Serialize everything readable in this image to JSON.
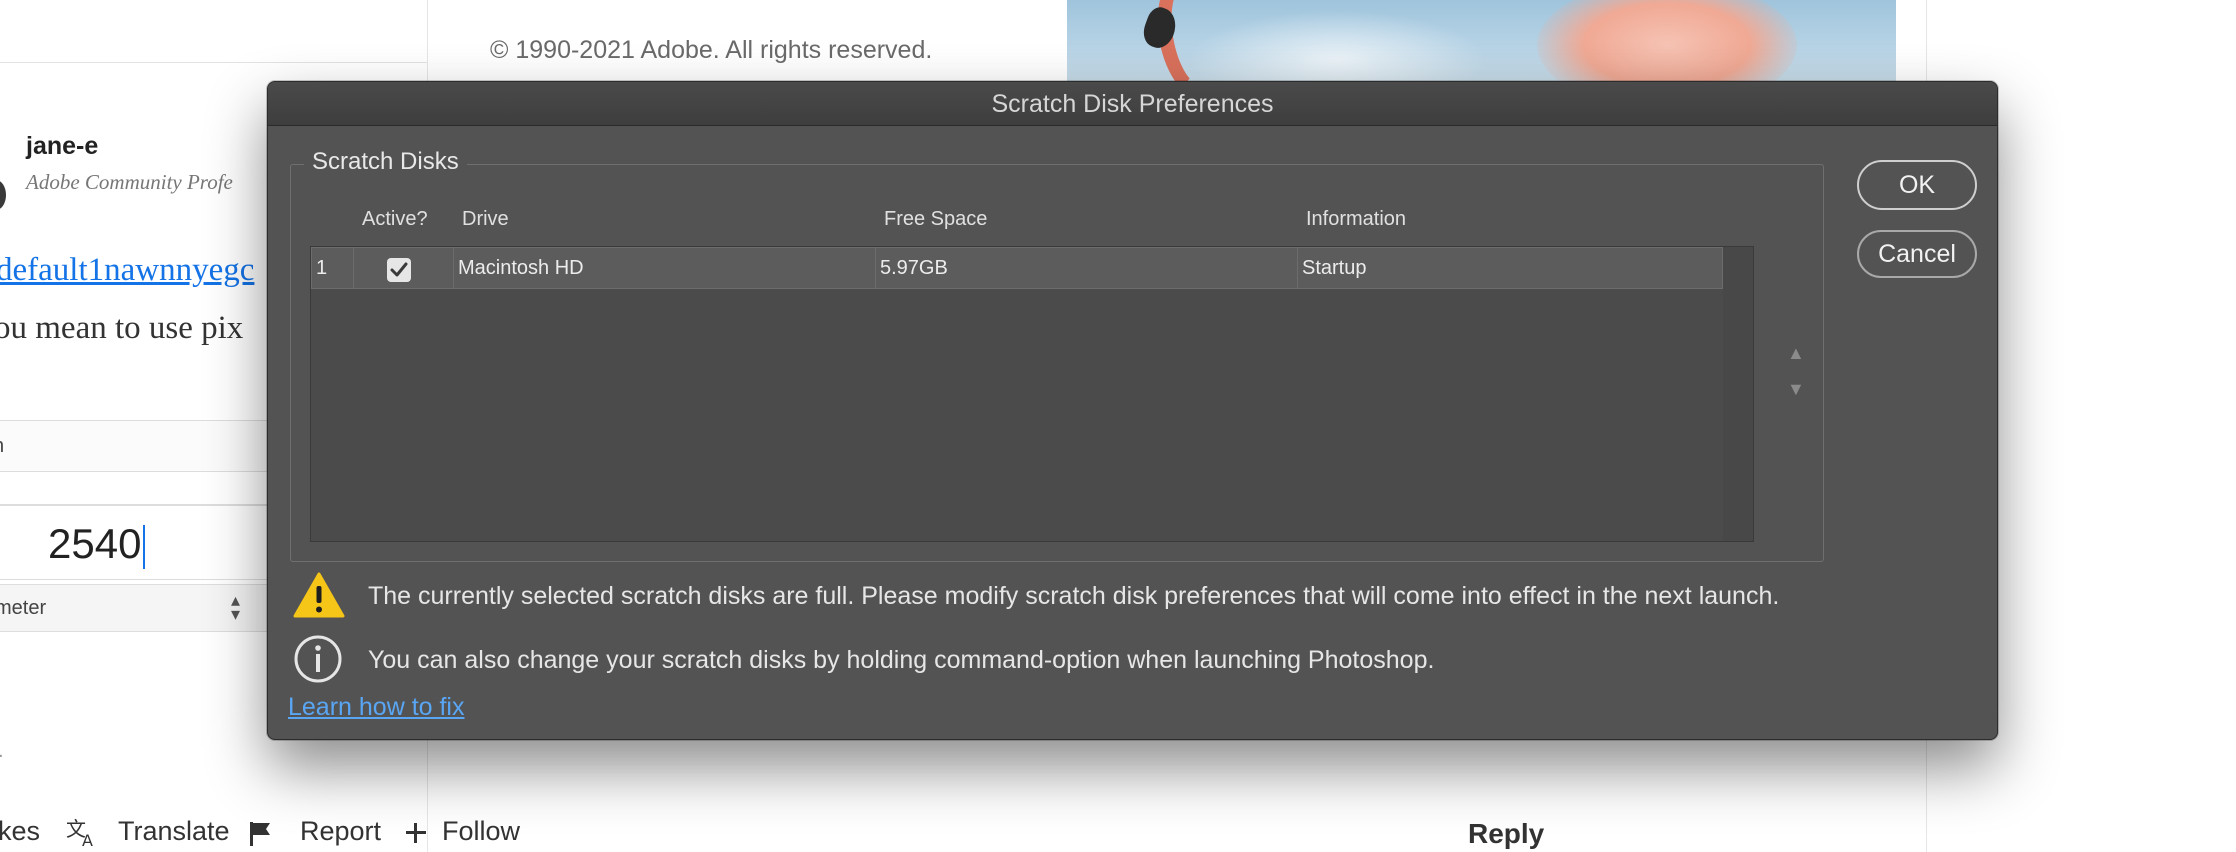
{
  "background": {
    "copyright": "© 1990-2021 Adobe. All rights reserved.",
    "post": {
      "username": "jane-e",
      "user_title": "Adobe Community Profe",
      "link_text": "default1nawnnyegc",
      "body_text": "ou mean to use pix"
    },
    "calculator": {
      "row_label": "n",
      "value": "2540",
      "unit": "meter"
    },
    "actions": {
      "likes": "kes",
      "translate": "Translate",
      "report": "Report",
      "follow": "Follow",
      "reply": "Reply"
    }
  },
  "dialog": {
    "title": "Scratch Disk Preferences",
    "group_label": "Scratch Disks",
    "columns": {
      "active": "Active?",
      "drive": "Drive",
      "free_space": "Free Space",
      "information": "Information"
    },
    "rows": [
      {
        "index": "1",
        "active": true,
        "drive": "Macintosh HD",
        "free_space": "5.97GB",
        "information": "Startup"
      }
    ],
    "buttons": {
      "ok": "OK",
      "cancel": "Cancel"
    },
    "warning_message": "The currently selected scratch disks are full. Please modify scratch disk preferences that will come into effect in the next launch.",
    "info_message": "You can also change your scratch disks by holding command-option when launching Photoshop.",
    "learn_link": "Learn how to fix"
  },
  "icons": {
    "warning": "warning-triangle-icon",
    "info": "info-circle-icon",
    "move_up": "move-up-arrow-icon",
    "move_down": "move-down-arrow-icon",
    "checkmark": "checkmark-icon",
    "translate": "translate-icon",
    "report": "flag-icon",
    "follow": "plus-icon"
  },
  "colors": {
    "dialog_bg": "#535353",
    "warning_yellow": "#f5c518",
    "link_blue": "#59a6f5"
  }
}
